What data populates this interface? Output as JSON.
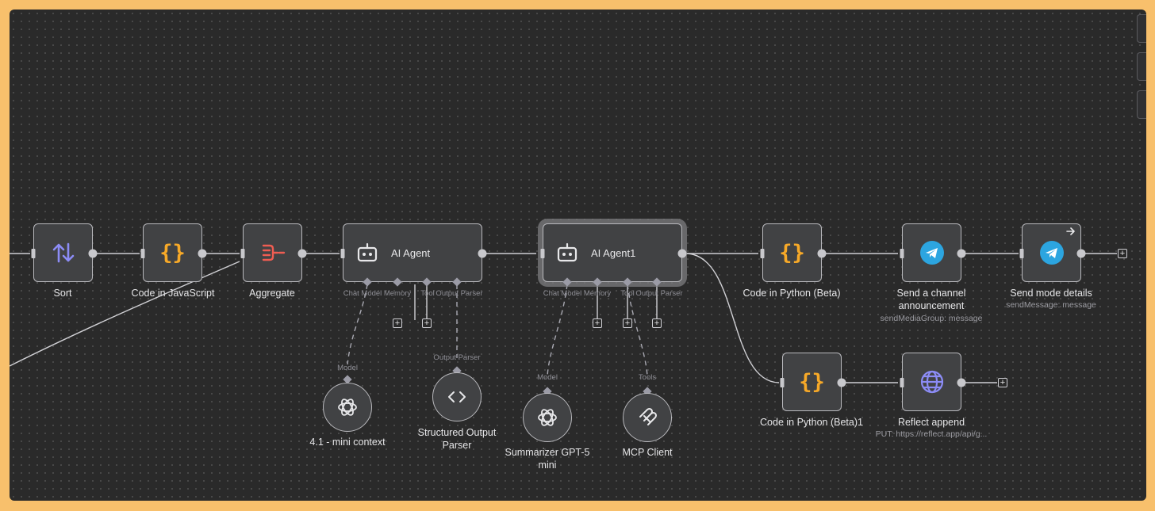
{
  "colors": {
    "page_bg": "#f8c06c",
    "canvas_bg": "#2a2a2a",
    "node_bg": "#414244",
    "code_orange": "#f7a928",
    "sort_purple": "#8c8cf6",
    "aggregate_red": "#ef5d52",
    "telegram_blue": "#2ca5e0",
    "http_purple": "#8c8cf6"
  },
  "nodes": {
    "sort": {
      "label": "Sort",
      "icon": "sort-arrows-icon"
    },
    "code_js": {
      "label": "Code in JavaScript",
      "icon": "curly-braces-icon"
    },
    "aggregate": {
      "label": "Aggregate",
      "icon": "aggregate-icon"
    },
    "ai_agent": {
      "title": "AI Agent",
      "icon": "robot-icon",
      "slots": [
        "Chat Model",
        "Memory",
        "Tool",
        "Output Parser"
      ]
    },
    "ai_agent1": {
      "title": "AI Agent1",
      "icon": "robot-icon",
      "slots": [
        "Chat Model",
        "Memory",
        "Tool",
        "Output Parser"
      ]
    },
    "code_py": {
      "label": "Code in Python (Beta)",
      "icon": "curly-braces-icon"
    },
    "send_channel": {
      "label_line1": "Send a channel",
      "label_line2": "announcement",
      "sublabel": "sendMediaGroup: message",
      "icon": "telegram-icon"
    },
    "send_mode": {
      "label": "Send mode details",
      "sublabel": "sendMessage: message",
      "icon": "telegram-icon"
    },
    "code_py1": {
      "label": "Code in Python (Beta)1",
      "icon": "curly-braces-icon"
    },
    "reflect": {
      "label": "Reflect append",
      "sublabel": "PUT: https://reflect.app/api/g...",
      "icon": "globe-icon"
    }
  },
  "sub_nodes": {
    "mini_context": {
      "label": "4.1 - mini context",
      "badge": "Model",
      "icon": "openai-icon"
    },
    "structured_parser": {
      "label_line1": "Structured Output",
      "label_line2": "Parser",
      "badge": "Output Parser",
      "icon": "code-brackets-icon"
    },
    "summarizer": {
      "label_line1": "Summarizer GPT-5",
      "label_line2": "mini",
      "badge": "Model",
      "icon": "openai-icon"
    },
    "mcp_client": {
      "label": "MCP Client",
      "badge": "Tools",
      "icon": "mcp-icon"
    }
  },
  "plus_symbol": "+"
}
